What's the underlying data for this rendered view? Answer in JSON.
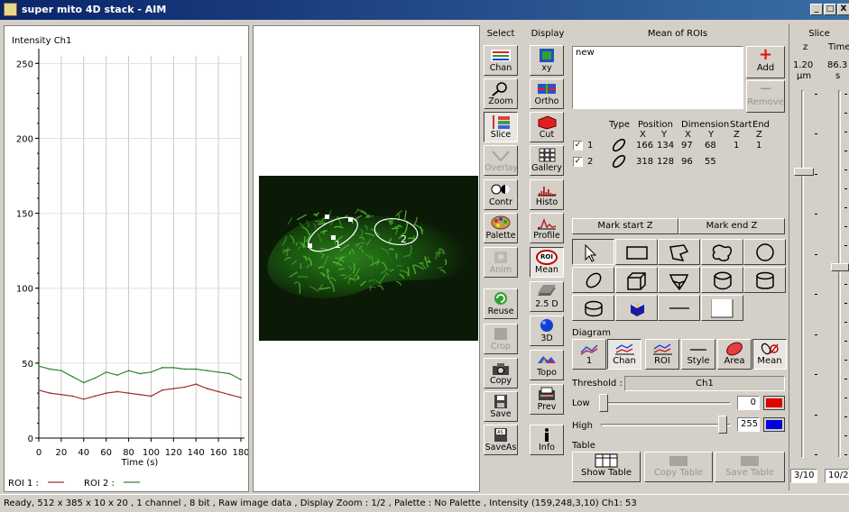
{
  "window": {
    "title": "super mito 4D stack - AIM",
    "buttons": [
      "_",
      "□",
      "X"
    ]
  },
  "plot": {
    "ylabel": "Intensity Ch1",
    "xlabel": "Time (s)",
    "legend": [
      {
        "label": "ROI 1 :",
        "color": "#a03030"
      },
      {
        "label": "ROI 2 :",
        "color": "#2a8a2a"
      }
    ]
  },
  "chart_data": {
    "type": "line",
    "title": "",
    "ylabel": "Intensity Ch1",
    "xlabel": "Time (s)",
    "xlim": [
      0,
      180
    ],
    "ylim": [
      0,
      255
    ],
    "xticks": [
      0,
      20,
      40,
      60,
      80,
      100,
      120,
      140,
      160,
      180
    ],
    "yticks": [
      0,
      50,
      100,
      150,
      200,
      250
    ],
    "grid": true,
    "legend_position": "bottom-left",
    "x": [
      0,
      10,
      20,
      30,
      40,
      50,
      60,
      70,
      80,
      90,
      100,
      110,
      120,
      130,
      140,
      150,
      160,
      170,
      180
    ],
    "series": [
      {
        "name": "ROI 1",
        "color": "#a03030",
        "values": [
          32,
          30,
          29,
          28,
          26,
          28,
          30,
          31,
          30,
          29,
          28,
          32,
          33,
          34,
          36,
          33,
          31,
          29,
          27
        ]
      },
      {
        "name": "ROI 2",
        "color": "#2a8a2a",
        "values": [
          48,
          46,
          45,
          41,
          37,
          40,
          44,
          42,
          45,
          43,
          44,
          47,
          47,
          46,
          46,
          45,
          44,
          43,
          39
        ]
      }
    ]
  },
  "select_col": {
    "header": "Select",
    "buttons": [
      {
        "label": "Chan",
        "state": "normal"
      },
      {
        "label": "Zoom",
        "state": "normal"
      },
      {
        "label": "Slice",
        "state": "pressed"
      },
      {
        "label": "Overlay",
        "state": "disabled"
      },
      {
        "label": "Contr",
        "state": "normal"
      },
      {
        "label": "Palette",
        "state": "normal"
      },
      {
        "label": "Anim",
        "state": "disabled"
      },
      {
        "label": "Reuse",
        "state": "normal"
      },
      {
        "label": "Crop",
        "state": "disabled"
      },
      {
        "label": "Copy",
        "state": "normal"
      },
      {
        "label": "Save",
        "state": "normal"
      },
      {
        "label": "SaveAs",
        "state": "normal"
      }
    ]
  },
  "display_col": {
    "header": "Display",
    "buttons": [
      {
        "label": "xy"
      },
      {
        "label": "Ortho"
      },
      {
        "label": "Cut"
      },
      {
        "label": "Gallery"
      },
      {
        "label": "Histo"
      },
      {
        "label": "Profile"
      },
      {
        "label": "Mean"
      },
      {
        "label": "2.5 D"
      },
      {
        "label": "3D"
      },
      {
        "label": "Topo"
      },
      {
        "label": "Prev"
      },
      {
        "label": "Info"
      }
    ],
    "roi_badge": "ROI"
  },
  "mean": {
    "header": "Mean of ROIs",
    "list_value": "new",
    "add_label": "Add",
    "remove_label": "Remove",
    "cols": {
      "type": "Type",
      "position": "Position",
      "dimension": "Dimension",
      "start": "Start",
      "end": "End",
      "x1": "X",
      "y1": "Y",
      "x2": "X",
      "y2": "Y",
      "z1": "Z",
      "z2": "Z"
    },
    "rows": [
      {
        "id": "1",
        "x": "166",
        "y": "134",
        "dx": "97",
        "dy": "68",
        "start": "1",
        "end": "1"
      },
      {
        "id": "2",
        "x": "318",
        "y": "128",
        "dx": "96",
        "dy": "55",
        "start": "",
        "end": ""
      }
    ],
    "mark_start": "Mark start Z",
    "mark_end": "Mark end Z",
    "diagram_label": "Diagram",
    "diagram_buttons": [
      "1",
      "Chan",
      "ROI",
      "Style",
      "Area",
      "Mean"
    ],
    "threshold_label": "Threshold :",
    "threshold_channel": "Ch1",
    "low_label": "Low",
    "low_value": "0",
    "low_level": 0,
    "low_color": "#e00000",
    "high_label": "High",
    "high_value": "255",
    "high_level": 1,
    "high_color": "#0000e0",
    "table_label": "Table",
    "table_buttons": [
      "Show Table",
      "Copy Table",
      "Save Table"
    ]
  },
  "slice": {
    "header": "Slice",
    "z_label": "z",
    "z_value": "1.20",
    "z_unit": "µm",
    "time_label": "Time",
    "time_value": "86.3",
    "time_unit": "s",
    "z_pos": "3/10",
    "t_pos": "10/2",
    "z_level": 0.22,
    "t_level": 0.48
  },
  "image": {
    "roi1_label": "1",
    "roi2_label": "2"
  },
  "status": "Ready, 512 x 385 x 10 x 20 , 1 channel , 8 bit , Raw image data , Display Zoom : 1/2 , Palette : No Palette , Intensity (159,248,3,10) Ch1: 53"
}
